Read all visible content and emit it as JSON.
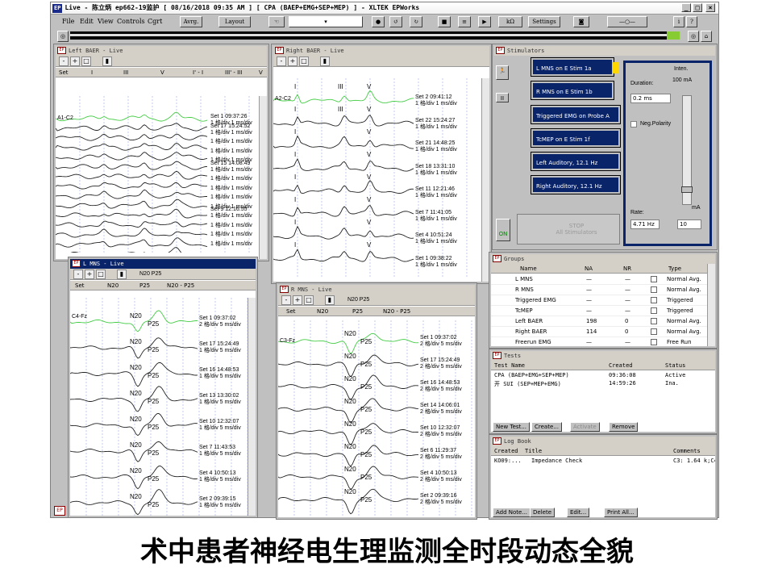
{
  "app": {
    "title_logo": "EP",
    "title": "Live - 陈立炳 ep662-19监护 [ 08/16/2018 09:35 AM ] [ CPA (BAEP+EMG+SEP+MEP) ] - XLTEK EPWorks",
    "menu": [
      "File",
      "Edit",
      "View",
      "Controls",
      "Cgrt"
    ],
    "toolbar": {
      "avg_label": "Avrg.",
      "layout_label": "Layout",
      "kohm_label": "kΩ",
      "settings_label": "Settings"
    }
  },
  "left_baer": {
    "title": "Left BAER - Live",
    "columns": [
      "Set",
      "I",
      "III",
      "V",
      "I' - I",
      "III' - III",
      "V"
    ],
    "channel": "A1-C2",
    "sets": [
      {
        "label": "Set 1 09:37:26",
        "scale": "1 格/div 1 ms/div"
      },
      {
        "label": "Set 17 15:24:52",
        "scale": "1 格/div 1 ms/div"
      },
      {
        "label": "",
        "scale": "1 格/div 1 ms/div"
      },
      {
        "label": "",
        "scale": "1 格/div 1 ms/div"
      },
      {
        "label": "",
        "scale": "1 格/div 1 ms/div"
      },
      {
        "label": "Set 15 14:08:49",
        "scale": "1 格/div 1 ms/div"
      },
      {
        "label": "",
        "scale": "1 格/div 1 ms/div"
      },
      {
        "label": "",
        "scale": "1 格/div 1 ms/div"
      },
      {
        "label": "",
        "scale": "1 格/div 1 ms/div"
      },
      {
        "label": "",
        "scale": "1 格/div 1 ms/div"
      },
      {
        "label": "Set 9 12:16:55",
        "scale": "1 格/div 1 ms/div"
      },
      {
        "label": "",
        "scale": "1 格/div 1 ms/div"
      },
      {
        "label": "",
        "scale": "1 格/div 1 ms/div"
      },
      {
        "label": "",
        "scale": "1 格/div 1 ms/div"
      },
      {
        "label": "",
        "scale": "1 格/div 1 ms/div"
      }
    ]
  },
  "right_baer": {
    "title": "Right BAER - Live",
    "channel": "A2-C2",
    "peaks": [
      "I",
      "III",
      "V"
    ],
    "sets": [
      {
        "label": "Set 2 09:41:12",
        "scale": "1 格/div 1 ms/div"
      },
      {
        "label": "Set 22 15:24:27",
        "scale": "1 格/div 1 ms/div"
      },
      {
        "label": "Set 21 14:48:25",
        "scale": "1 格/div 1 ms/div"
      },
      {
        "label": "Set 18 13:31:10",
        "scale": "1 格/div 1 ms/div"
      },
      {
        "label": "Set 11 12:21:46",
        "scale": "1 格/div 1 ms/div"
      },
      {
        "label": "Set 7 11:41:05",
        "scale": "1 格/div 1 ms/div"
      },
      {
        "label": "Set 4 10:51:24",
        "scale": "1 格/div 1 ms/div"
      },
      {
        "label": "Set 1 09:38:22",
        "scale": "1 格/div 1 ms/div"
      }
    ]
  },
  "l_mns": {
    "title": "L MNS - Live",
    "n20p25": "N20 P25",
    "columns": [
      "Set",
      "N20",
      "P25",
      "N20 - P25"
    ],
    "channel": "C4-Fz",
    "sets": [
      {
        "label": "Set 1 09:37:02",
        "scale": "2 格/div 5 ms/div"
      },
      {
        "label": "Set 17 15:24:49",
        "scale": "1 格/div 5 ms/div"
      },
      {
        "label": "Set 16 14:48:53",
        "scale": "1 格/div 5 ms/div"
      },
      {
        "label": "Set 13 13:30:02",
        "scale": "1 格/div 5 ms/div"
      },
      {
        "label": "Set 10 12:32:07",
        "scale": "1 格/div 5 ms/div"
      },
      {
        "label": "Set 7 11:43:53",
        "scale": "1 格/div 5 ms/div"
      },
      {
        "label": "Set 4 10:50:13",
        "scale": "1 格/div 5 ms/div"
      },
      {
        "label": "Set 2 09:39:15",
        "scale": "1 格/div 5 ms/div"
      }
    ]
  },
  "r_mns": {
    "title": "R MNS - Live",
    "n20p25": "N20 P25",
    "columns": [
      "Set",
      "N20",
      "P25",
      "N20 - P25"
    ],
    "channel": "C3-Fz",
    "sets": [
      {
        "label": "Set 1 09:37:02",
        "scale": "2 格/div 5 ms/div"
      },
      {
        "label": "Set 17 15:24:49",
        "scale": "2 格/div 5 ms/div"
      },
      {
        "label": "Set 16 14:48:53",
        "scale": "2 格/div 5 ms/div"
      },
      {
        "label": "Set 14 14:06:01",
        "scale": "2 格/div 5 ms/div"
      },
      {
        "label": "Set 10 12:32:07",
        "scale": "2 格/div 5 ms/div"
      },
      {
        "label": "Set 6 11:29:37",
        "scale": "2 格/div 5 ms/div"
      },
      {
        "label": "Set 4 10:50:13",
        "scale": "2 格/div 5 ms/div"
      },
      {
        "label": "Set 2 09:39:16",
        "scale": "2 格/div 5 ms/div"
      }
    ]
  },
  "stimulators": {
    "title": "Stimulators",
    "items": [
      "L MNS on E Stim 1a",
      "R MNS on E Stim 1b",
      "Triggered EMG on Probe A",
      "TcMEP on E Stim 1f",
      "Left Auditory, 12.1 Hz",
      "Right Auditory, 12.1 Hz"
    ],
    "duration_label": "Duration:",
    "duration_value": "0.2 ms",
    "inten_label": "Inten.",
    "inten_value": "100 mA",
    "ma_label": "mA",
    "neg_polarity": "Neg.Polarity",
    "rate_label": "Rate:",
    "rate_value": "4.71 Hz",
    "rate_box": "10",
    "on_label": "ON",
    "stop_label": "STOP",
    "stop_sub": "All Stimulators"
  },
  "groups": {
    "title": "Groups",
    "headers": [
      "Name",
      "NA",
      "NR",
      "Type"
    ],
    "rows": [
      {
        "name": "L MNS",
        "na": "—",
        "nr": "—",
        "type": "Normal Avg."
      },
      {
        "name": "R MNS",
        "na": "—",
        "nr": "—",
        "type": "Normal Avg."
      },
      {
        "name": "Triggered EMG",
        "na": "—",
        "nr": "—",
        "type": "Triggered"
      },
      {
        "name": "TcMEP",
        "na": "—",
        "nr": "—",
        "type": "Triggered"
      },
      {
        "name": "Left BAER",
        "na": "198",
        "nr": "0",
        "type": "Normal Avg."
      },
      {
        "name": "Right BAER",
        "na": "114",
        "nr": "0",
        "type": "Normal Avg."
      },
      {
        "name": "Freerun EMG",
        "na": "—",
        "nr": "—",
        "type": "Free Run"
      }
    ]
  },
  "tests": {
    "title": "Tests",
    "headers": [
      "Test Name",
      "Created",
      "Status"
    ],
    "rows": [
      {
        "name": "CPA (BAEP+EMG+SEP+MEP)",
        "created": "09:36:08",
        "status": "Active"
      },
      {
        "name": "开 SUI (SEP+MEP+EMG)",
        "created": "14:59:26",
        "status": "Ina."
      }
    ],
    "buttons": [
      "New Test...",
      "Create...",
      "Activate",
      "Remove"
    ]
  },
  "logbook": {
    "title": "Log Book",
    "headers": [
      "Created",
      "Title",
      "Comments"
    ],
    "rows": [
      {
        "created": "KO09:...",
        "title": "Impedance Check",
        "comments": "C3: 1.64 k;C4"
      }
    ],
    "buttons": [
      "Add Note...",
      "Delete",
      "Edit...",
      "Print All..."
    ]
  },
  "caption": "术中患者神经电生理监测全时段动态全貌"
}
